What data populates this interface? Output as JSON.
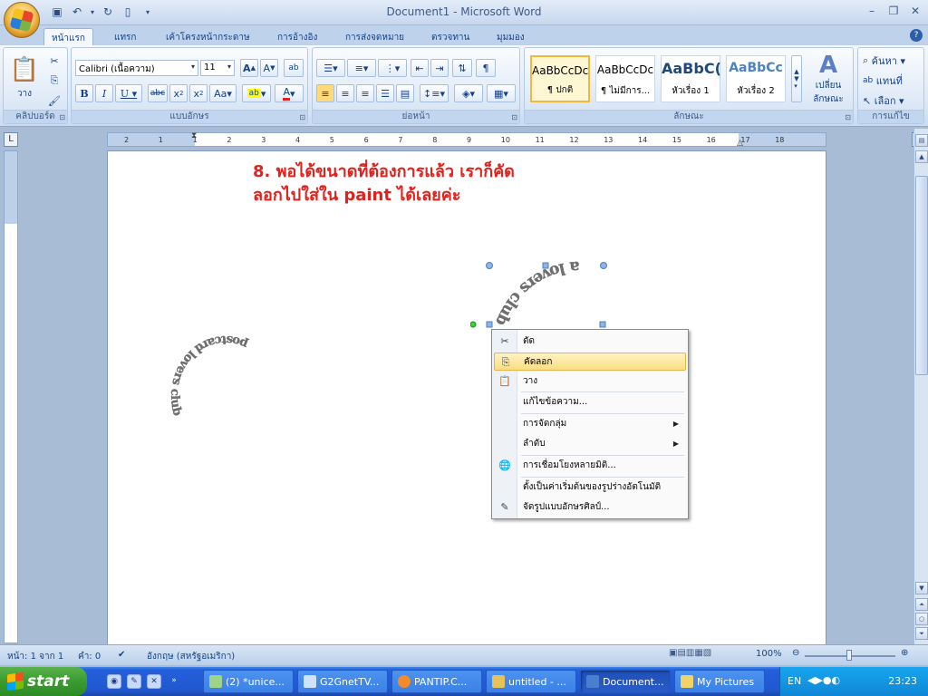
{
  "window": {
    "title": "Document1 - Microsoft Word"
  },
  "tabs": [
    {
      "label": "หน้าแรก",
      "active": true
    },
    {
      "label": "แทรก"
    },
    {
      "label": "เค้าโครงหน้ากระดาษ"
    },
    {
      "label": "การอ้างอิง"
    },
    {
      "label": "การส่งจดหมาย"
    },
    {
      "label": "ตรวจทาน"
    },
    {
      "label": "มุมมอง"
    }
  ],
  "ribbon": {
    "clipboard": {
      "label": "คลิปบอร์ด",
      "paste": "วาง"
    },
    "font": {
      "label": "แบบอักษร",
      "font_name": "Calibri (เนื้อความ)",
      "font_size": "11"
    },
    "paragraph": {
      "label": "ย่อหน้า"
    },
    "styles": {
      "label": "ลักษณะ",
      "items": [
        {
          "sample": "AaBbCcDc",
          "name": "¶ ปกติ"
        },
        {
          "sample": "AaBbCcDc",
          "name": "¶ ไม่มีการ..."
        },
        {
          "sample": "AaBbC(",
          "name": "หัวเรื่อง 1"
        },
        {
          "sample": "AaBbCc",
          "name": "หัวเรื่อง 2"
        }
      ],
      "change_styles": "เปลี่ยน ลักษณะ"
    },
    "editing": {
      "label": "การแก้ไข",
      "find": "ค้นหา",
      "replace": "แทนที่",
      "select": "เลือก"
    }
  },
  "ruler": {
    "ticks": [
      "2",
      "1",
      "1",
      "2",
      "3",
      "4",
      "5",
      "6",
      "7",
      "8",
      "9",
      "10",
      "11",
      "12",
      "13",
      "14",
      "15",
      "16",
      "17",
      "18"
    ]
  },
  "document": {
    "instruction_line1": "8. พอได้ขนาดที่ต้องการแล้ว เราก็คัด",
    "instruction_line2": "ลอกไปใส่ใน paint ได้เลยค่ะ",
    "arc_text_left": "postcard lovers club",
    "arc_text_right": "a lovers club"
  },
  "context_menu": {
    "items": [
      {
        "label": "ตัด",
        "icon": "scissors-icon"
      },
      {
        "label": "คัดลอก",
        "icon": "copy-icon",
        "highlighted": true
      },
      {
        "label": "วาง",
        "icon": "paste-icon"
      },
      {
        "label": "แก้ไขข้อความ..."
      },
      {
        "label": "การจัดกลุ่ม",
        "submenu": true
      },
      {
        "label": "ลำดับ",
        "submenu": true
      },
      {
        "label": "การเชื่อมโยงหลายมิติ...",
        "icon": "hyperlink-icon"
      },
      {
        "label": "ตั้งเป็นค่าเริ่มต้นของรูปร่างอัตโนมัติ"
      },
      {
        "label": "จัดรูปแบบอักษรศิลป์...",
        "icon": "format-icon"
      }
    ]
  },
  "status": {
    "page": "หน้า: 1 จาก 1",
    "words": "คำ: 0",
    "language": "อังกฤษ (สหรัฐอเมริกา)",
    "zoom": "100%"
  },
  "taskbar": {
    "start": "start",
    "tasks": [
      {
        "label": "(2) *unice..."
      },
      {
        "label": "G2GnetTV..."
      },
      {
        "label": "PANTIP.C..."
      },
      {
        "label": "untitled - ..."
      },
      {
        "label": "Document...",
        "active": true
      },
      {
        "label": "My Pictures"
      }
    ],
    "lang": "EN",
    "clock": "23:23"
  }
}
